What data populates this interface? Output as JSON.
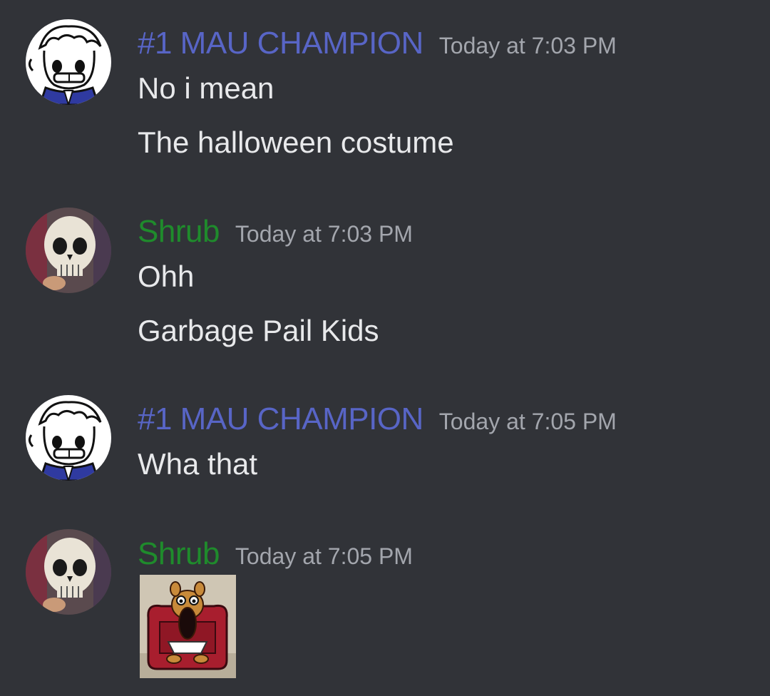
{
  "messages": [
    {
      "username": "#1 MAU CHAMPION",
      "timestamp": "Today at 7:03 PM",
      "lines": [
        "No i mean",
        "The halloween costume"
      ]
    },
    {
      "username": "Shrub",
      "timestamp": "Today at 7:03 PM",
      "lines": [
        "Ohh",
        "Garbage Pail Kids"
      ]
    },
    {
      "username": "#1 MAU CHAMPION",
      "timestamp": "Today at 7:05 PM",
      "lines": [
        "Wha that"
      ]
    },
    {
      "username": "Shrub",
      "timestamp": "Today at 7:05 PM",
      "lines": []
    }
  ],
  "colors": {
    "background": "#313338",
    "champion_name": "#5865c6",
    "shrub_name": "#1f8b2c",
    "timestamp": "#a3a6ad",
    "message_text": "#e8e9eb"
  },
  "icons": {
    "champion_avatar": "cartoon-character-avatar-icon",
    "shrub_avatar": "skull-avatar-icon",
    "attachment": "cartoon-dog-armchair-image"
  }
}
